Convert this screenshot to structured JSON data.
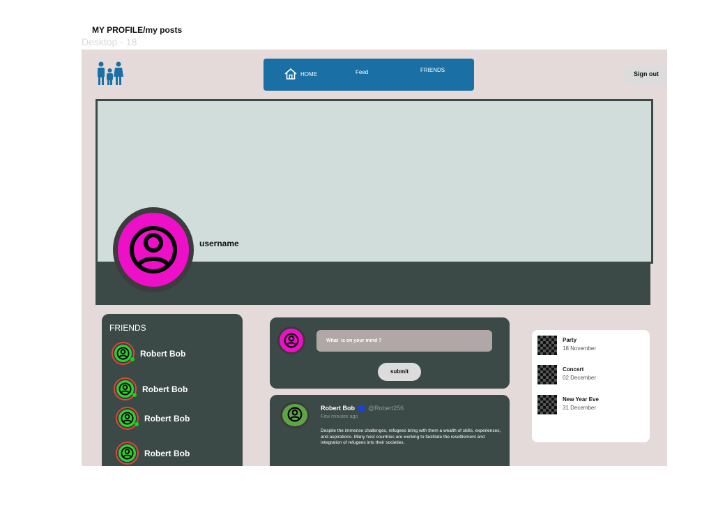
{
  "frame": {
    "title": "MY PROFILE/my posts",
    "subtitle": "Desktop - 18"
  },
  "header": {
    "logo_icon": "family-icon",
    "nav": {
      "home_label": "HOME",
      "feed_label": "Feed",
      "friends_label": "FRIENDS"
    },
    "signout_label": "Sign out"
  },
  "profile": {
    "username": "username",
    "avatar_color": "#ee10c8"
  },
  "friends": {
    "title": "FRIENDS",
    "items": [
      {
        "name": "Robert Bob",
        "online": true
      },
      {
        "name": "Robert Bob",
        "online": true
      },
      {
        "name": "Robert Bob",
        "online": true
      },
      {
        "name": "Robert Bob",
        "online": false
      }
    ]
  },
  "composer": {
    "placeholder": "What  is on your mind ?",
    "submit_label": "submit"
  },
  "post": {
    "author": "Robert Bob",
    "handle": "@Robert256",
    "time": "Few minutes ago",
    "body": "Despite the immense challenges, refugees bring with them a wealth of skills, experiences, and aspirations. Many host countries are working to facilitate the resettlement and integration of refugees into their societies."
  },
  "events": [
    {
      "name": "Party",
      "date": "18 November"
    },
    {
      "name": "Concert",
      "date": "02 December"
    },
    {
      "name": "New Year Eve",
      "date": "31 December"
    }
  ],
  "colors": {
    "nav": "#1a6fa4",
    "panel": "#3b4a46",
    "canvas": "#e4dad9",
    "accent_pink": "#ee10c8",
    "online": "#17d517"
  }
}
